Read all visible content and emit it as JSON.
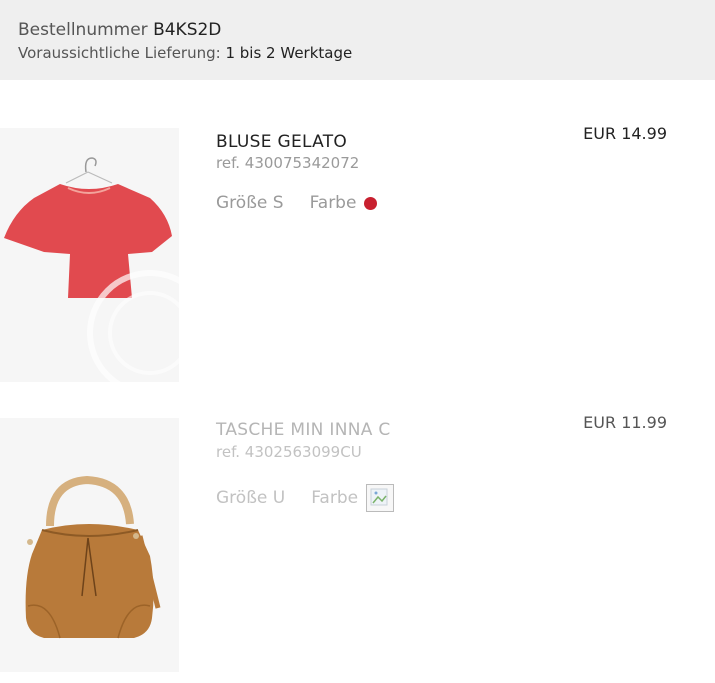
{
  "order": {
    "number_label": "Bestellnummer",
    "number_value": "B4KS2D",
    "delivery_label": "Voraussichtliche Lieferung:",
    "delivery_value": "1 bis 2 Werktage"
  },
  "items": [
    {
      "name": "BLUSE GELATO",
      "ref": "ref. 430075342072",
      "size_label": "Größe S",
      "color_label": "Farbe",
      "color_hex": "#c8202f",
      "price": "EUR 14.99",
      "image_icon": "red-blouse-image"
    },
    {
      "name": "TASCHE MIN INNA C",
      "ref": "ref. 4302563099CU",
      "size_label": "Größe U",
      "color_label": "Farbe",
      "color_icon": "broken-image-icon",
      "price": "EUR 11.99",
      "image_icon": "tan-bucket-bag-image"
    }
  ],
  "colors": {
    "header_bg": "#efefef",
    "blouse_red": "#e14a4f",
    "bag_tan": "#b87a3a"
  }
}
